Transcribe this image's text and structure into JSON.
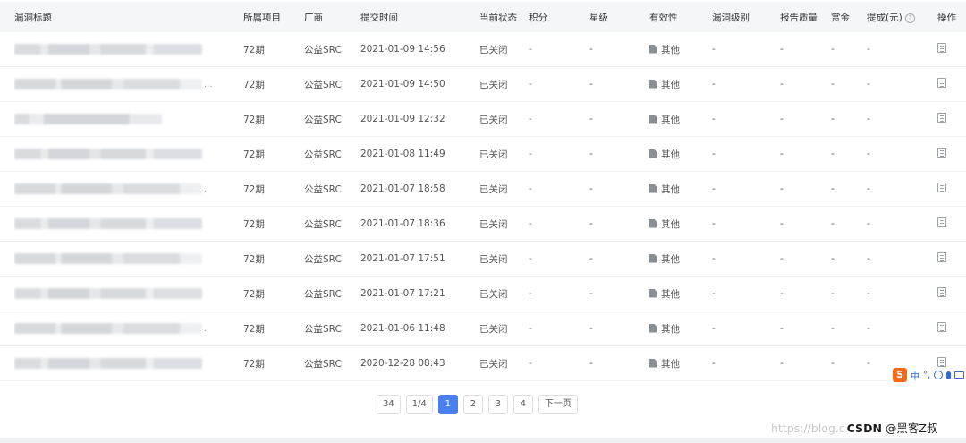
{
  "columns": [
    "漏洞标题",
    "所属项目",
    "厂商",
    "提交时间",
    "当前状态",
    "积分",
    "星级",
    "有效性",
    "漏洞级别",
    "报告质量",
    "赏金",
    "提成(元)",
    "操作"
  ],
  "help_icon_glyph": "?",
  "rows": [
    {
      "ellipsis": "",
      "project": "72期",
      "vendor": "公益SRC",
      "time": "2021-01-09 14:56",
      "status": "已关闭",
      "score": "-",
      "star": "-",
      "validity": "其他",
      "level": "-",
      "quality": "-",
      "bounty": "-",
      "commission": "-"
    },
    {
      "ellipsis": "...",
      "project": "72期",
      "vendor": "公益SRC",
      "time": "2021-01-09 14:50",
      "status": "已关闭",
      "score": "-",
      "star": "-",
      "validity": "其他",
      "level": "-",
      "quality": "-",
      "bounty": "-",
      "commission": "-"
    },
    {
      "ellipsis": "",
      "project": "72期",
      "vendor": "公益SRC",
      "time": "2021-01-09 12:32",
      "status": "已关闭",
      "score": "-",
      "star": "-",
      "validity": "其他",
      "level": "-",
      "quality": "-",
      "bounty": "-",
      "commission": "-"
    },
    {
      "ellipsis": "",
      "project": "72期",
      "vendor": "公益SRC",
      "time": "2021-01-08 11:49",
      "status": "已关闭",
      "score": "-",
      "star": "-",
      "validity": "其他",
      "level": "-",
      "quality": "-",
      "bounty": "-",
      "commission": "-"
    },
    {
      "ellipsis": ".",
      "project": "72期",
      "vendor": "公益SRC",
      "time": "2021-01-07 18:58",
      "status": "已关闭",
      "score": "-",
      "star": "-",
      "validity": "其他",
      "level": "-",
      "quality": "-",
      "bounty": "-",
      "commission": "-"
    },
    {
      "ellipsis": "",
      "project": "72期",
      "vendor": "公益SRC",
      "time": "2021-01-07 18:36",
      "status": "已关闭",
      "score": "-",
      "star": "-",
      "validity": "其他",
      "level": "-",
      "quality": "-",
      "bounty": "-",
      "commission": "-"
    },
    {
      "ellipsis": "",
      "project": "72期",
      "vendor": "公益SRC",
      "time": "2021-01-07 17:51",
      "status": "已关闭",
      "score": "-",
      "star": "-",
      "validity": "其他",
      "level": "-",
      "quality": "-",
      "bounty": "-",
      "commission": "-"
    },
    {
      "ellipsis": "",
      "project": "72期",
      "vendor": "公益SRC",
      "time": "2021-01-07 17:21",
      "status": "已关闭",
      "score": "-",
      "star": "-",
      "validity": "其他",
      "level": "-",
      "quality": "-",
      "bounty": "-",
      "commission": "-"
    },
    {
      "ellipsis": ".",
      "project": "72期",
      "vendor": "公益SRC",
      "time": "2021-01-06 11:48",
      "status": "已关闭",
      "score": "-",
      "star": "-",
      "validity": "其他",
      "level": "-",
      "quality": "-",
      "bounty": "-",
      "commission": "-"
    },
    {
      "ellipsis": "",
      "project": "72期",
      "vendor": "公益SRC",
      "time": "2020-12-28 08:43",
      "status": "已关闭",
      "score": "-",
      "star": "-",
      "validity": "其他",
      "level": "-",
      "quality": "-",
      "bounty": "-",
      "commission": "-"
    }
  ],
  "pagination": {
    "total": "34",
    "page_of": "1/4",
    "pages": [
      "1",
      "2",
      "3",
      "4"
    ],
    "current": "1",
    "next_label": "下一页"
  },
  "ime_toolbar": {
    "logo": "S",
    "lang": "中",
    "punct": "°,"
  },
  "watermark": {
    "url_fragment": "https://blog.c",
    "brand": "CSDN",
    "author": "@黑客Z叔"
  },
  "colors": {
    "accent": "#4a7ff0",
    "header_bg": "#f4f6f8",
    "ime_brand": "#f26b1d"
  }
}
